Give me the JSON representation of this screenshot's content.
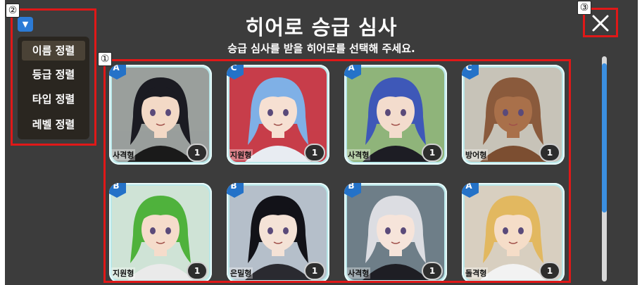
{
  "header": {
    "title": "히어로 승급 심사",
    "subtitle": "승급 심사를 받을 히어로를 선택해 주세요."
  },
  "annotations": {
    "grid": "①",
    "sort": "②",
    "close": "③"
  },
  "sort_menu": {
    "toggle_icon": "▼",
    "items": [
      {
        "label": "이름 정렬",
        "active": true
      },
      {
        "label": "등급 정렬"
      },
      {
        "label": "타입 정렬"
      },
      {
        "label": "레벨 정렬"
      }
    ]
  },
  "close_icon": "close-x-icon",
  "scrollbar": {
    "position": 0.05
  },
  "heroes": [
    {
      "grade": "A",
      "type": "사격형",
      "level": "1",
      "hair": "#1b1b22",
      "skin": "#f3d9c6",
      "bg": "#9a9f9c",
      "cloth": "#1a1a1a"
    },
    {
      "grade": "C",
      "type": "지원형",
      "level": "1",
      "hair": "#7fb0e6",
      "skin": "#f6e0d2",
      "bg": "#c73d4a",
      "cloth": "#e8ecf2"
    },
    {
      "grade": "A",
      "type": "사격형",
      "level": "1",
      "hair": "#3e58b8",
      "skin": "#f3dccd",
      "bg": "#8fb47a",
      "cloth": "#1d1d24"
    },
    {
      "grade": "C",
      "type": "방어형",
      "level": "1",
      "hair": "#8a5a3c",
      "skin": "#a9704a",
      "bg": "#c7c3b8",
      "cloth": "#7c4e31"
    },
    {
      "grade": "B",
      "type": "지원형",
      "level": "1",
      "hair": "#4fb23c",
      "skin": "#f5dccb",
      "bg": "#cfe3d6",
      "cloth": "#eaeaea"
    },
    {
      "grade": "B",
      "type": "은밀형",
      "level": "1",
      "hair": "#121218",
      "skin": "#f4e2d6",
      "bg": "#b5bfca",
      "cloth": "#2a2a30"
    },
    {
      "grade": "B",
      "type": "사격형",
      "level": "1",
      "hair": "#dcdde2",
      "skin": "#f6e4da",
      "bg": "#6e7e88",
      "cloth": "#1e1e24"
    },
    {
      "grade": "A",
      "type": "돌격형",
      "level": "1",
      "hair": "#e2b860",
      "skin": "#f5ddc8",
      "bg": "#d8cfc0",
      "cloth": "#f2f2f2"
    }
  ],
  "colors": {
    "highlight": "#e01818",
    "grade_badge": "#2472c8",
    "scroll_thumb": "#3b8fe0",
    "panel_bg": "#3c3c3c"
  }
}
